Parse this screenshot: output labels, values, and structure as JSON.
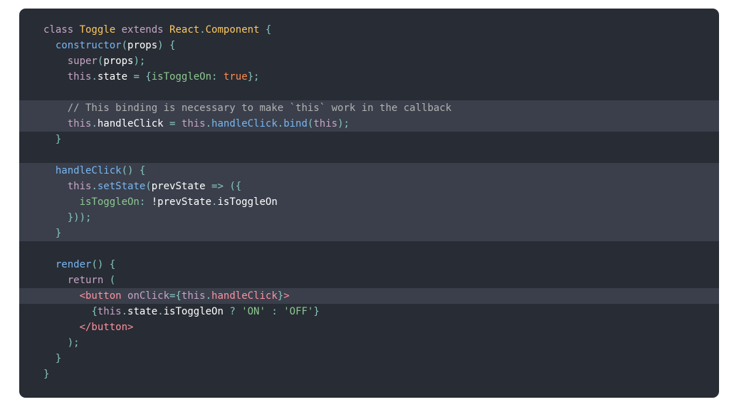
{
  "code": {
    "language": "jsx",
    "lines": [
      {
        "indent": 0,
        "highlight": false,
        "tokens": [
          [
            "kw",
            "class "
          ],
          [
            "cls",
            "Toggle "
          ],
          [
            "kw",
            "extends "
          ],
          [
            "cls",
            "React"
          ],
          [
            "pun",
            "."
          ],
          [
            "cls",
            "Component "
          ],
          [
            "pun",
            "{"
          ]
        ]
      },
      {
        "indent": 1,
        "highlight": false,
        "tokens": [
          [
            "fn",
            "constructor"
          ],
          [
            "pun",
            "("
          ],
          [
            "txt",
            "props"
          ],
          [
            "pun",
            ") {"
          ]
        ]
      },
      {
        "indent": 2,
        "highlight": false,
        "tokens": [
          [
            "kw",
            "super"
          ],
          [
            "pun",
            "("
          ],
          [
            "txt",
            "props"
          ],
          [
            "pun",
            ");"
          ]
        ]
      },
      {
        "indent": 2,
        "highlight": false,
        "tokens": [
          [
            "kw",
            "this"
          ],
          [
            "pun",
            "."
          ],
          [
            "txt",
            "state "
          ],
          [
            "pun",
            "= {"
          ],
          [
            "prop",
            "isToggleOn"
          ],
          [
            "pun",
            ": "
          ],
          [
            "bool",
            "true"
          ],
          [
            "pun",
            "};"
          ]
        ]
      },
      {
        "indent": 0,
        "highlight": false,
        "tokens": []
      },
      {
        "indent": 2,
        "highlight": true,
        "tokens": [
          [
            "cm",
            "// This binding is necessary to make `this` work in the callback"
          ]
        ]
      },
      {
        "indent": 2,
        "highlight": true,
        "tokens": [
          [
            "kw",
            "this"
          ],
          [
            "pun",
            "."
          ],
          [
            "txt",
            "handleClick "
          ],
          [
            "pun",
            "= "
          ],
          [
            "kw",
            "this"
          ],
          [
            "pun",
            "."
          ],
          [
            "fn",
            "handleClick"
          ],
          [
            "pun",
            "."
          ],
          [
            "fn",
            "bind"
          ],
          [
            "pun",
            "("
          ],
          [
            "kw",
            "this"
          ],
          [
            "pun",
            ");"
          ]
        ]
      },
      {
        "indent": 1,
        "highlight": false,
        "tokens": [
          [
            "pun",
            "}"
          ]
        ]
      },
      {
        "indent": 0,
        "highlight": false,
        "tokens": []
      },
      {
        "indent": 1,
        "highlight": true,
        "tokens": [
          [
            "fn",
            "handleClick"
          ],
          [
            "pun",
            "() {"
          ]
        ]
      },
      {
        "indent": 2,
        "highlight": true,
        "tokens": [
          [
            "kw",
            "this"
          ],
          [
            "pun",
            "."
          ],
          [
            "fn",
            "setState"
          ],
          [
            "pun",
            "("
          ],
          [
            "txt",
            "prevState "
          ],
          [
            "pun",
            "=> ({"
          ]
        ]
      },
      {
        "indent": 3,
        "highlight": true,
        "tokens": [
          [
            "prop",
            "isToggleOn"
          ],
          [
            "pun",
            ": "
          ],
          [
            "txt",
            "!prevState"
          ],
          [
            "pun",
            "."
          ],
          [
            "txt",
            "isToggleOn"
          ]
        ]
      },
      {
        "indent": 2,
        "highlight": true,
        "tokens": [
          [
            "pun",
            "}));"
          ]
        ]
      },
      {
        "indent": 1,
        "highlight": true,
        "tokens": [
          [
            "pun",
            "}"
          ]
        ]
      },
      {
        "indent": 0,
        "highlight": false,
        "tokens": []
      },
      {
        "indent": 1,
        "highlight": false,
        "tokens": [
          [
            "fn",
            "render"
          ],
          [
            "pun",
            "() {"
          ]
        ]
      },
      {
        "indent": 2,
        "highlight": false,
        "tokens": [
          [
            "kw",
            "return "
          ],
          [
            "pun",
            "("
          ]
        ]
      },
      {
        "indent": 3,
        "highlight": true,
        "tokens": [
          [
            "tag",
            "<button "
          ],
          [
            "attr",
            "onClick"
          ],
          [
            "pun",
            "={"
          ],
          [
            "kw",
            "this"
          ],
          [
            "pun",
            "."
          ],
          [
            "tag",
            "handleClick"
          ],
          [
            "pun",
            "}"
          ],
          [
            "tag",
            ">"
          ]
        ]
      },
      {
        "indent": 4,
        "highlight": false,
        "tokens": [
          [
            "pun",
            "{"
          ],
          [
            "kw",
            "this"
          ],
          [
            "pun",
            "."
          ],
          [
            "txt",
            "state"
          ],
          [
            "pun",
            "."
          ],
          [
            "txt",
            "isToggleOn "
          ],
          [
            "pun",
            "? "
          ],
          [
            "str",
            "'ON'"
          ],
          [
            "pun",
            " : "
          ],
          [
            "str",
            "'OFF'"
          ],
          [
            "pun",
            "}"
          ]
        ]
      },
      {
        "indent": 3,
        "highlight": false,
        "tokens": [
          [
            "tag",
            "</button>"
          ]
        ]
      },
      {
        "indent": 2,
        "highlight": false,
        "tokens": [
          [
            "pun",
            ");"
          ]
        ]
      },
      {
        "indent": 1,
        "highlight": false,
        "tokens": [
          [
            "pun",
            "}"
          ]
        ]
      },
      {
        "indent": 0,
        "highlight": false,
        "tokens": [
          [
            "pun",
            "}"
          ]
        ]
      }
    ]
  }
}
